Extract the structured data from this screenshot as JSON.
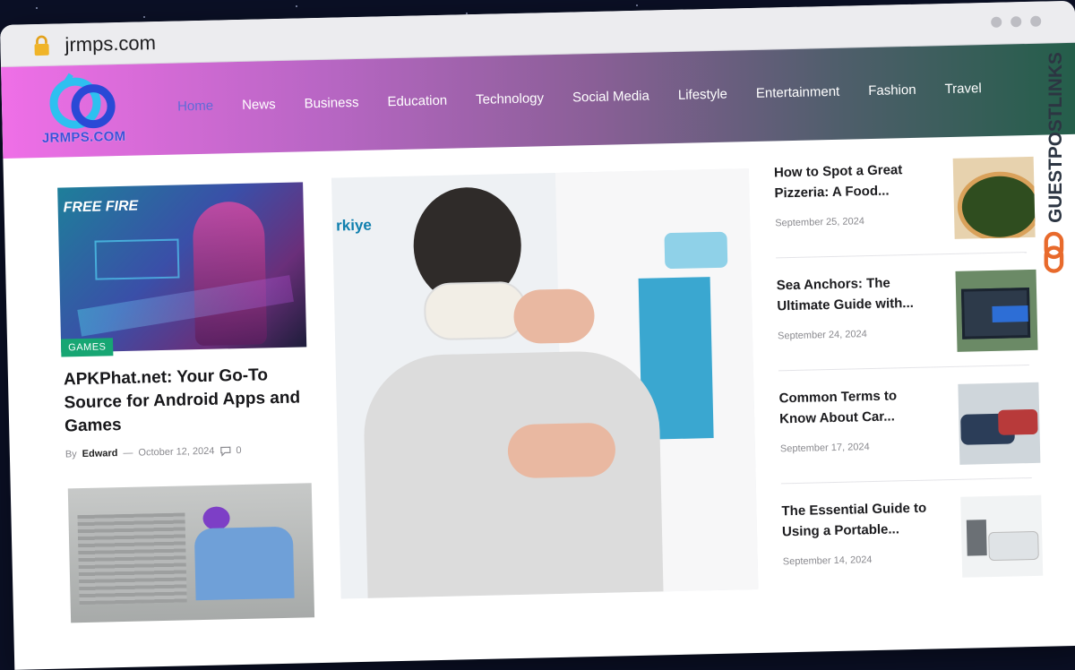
{
  "browser": {
    "url": "jrmps.com"
  },
  "site": {
    "logo_text": "JRMPS.COM",
    "nav": [
      "Home",
      "News",
      "Business",
      "Education",
      "Technology",
      "Social Media",
      "Lifestyle",
      "Entertainment",
      "Fashion",
      "Travel"
    ],
    "active_nav": "Home",
    "watermark": "GUESTPOSTLINKS"
  },
  "featured": {
    "image_text": "FREE FIRE",
    "tag": "GAMES",
    "title": "APKPhat.net: Your Go-To Source for Android Apps and Games",
    "by": "By",
    "author": "Edward",
    "dash": "—",
    "date": "October 12, 2024",
    "comments": "0"
  },
  "center_image": {
    "partial_text": "rkiye"
  },
  "sidebar": [
    {
      "title": "How to Spot a Great Pizzeria: A Food...",
      "date": "September 25, 2024",
      "thumb": "pizza"
    },
    {
      "title": "Sea Anchors: The Ultimate Guide with...",
      "date": "September 24, 2024",
      "thumb": "sea-anchor"
    },
    {
      "title": "Common Terms to Know About Car...",
      "date": "September 17, 2024",
      "thumb": "car"
    },
    {
      "title": "The Essential Guide to Using a Portable...",
      "date": "September 14, 2024",
      "thumb": "heater"
    }
  ],
  "colors": {
    "tag_green": "#17a673",
    "active_nav": "#5f6ad8"
  }
}
